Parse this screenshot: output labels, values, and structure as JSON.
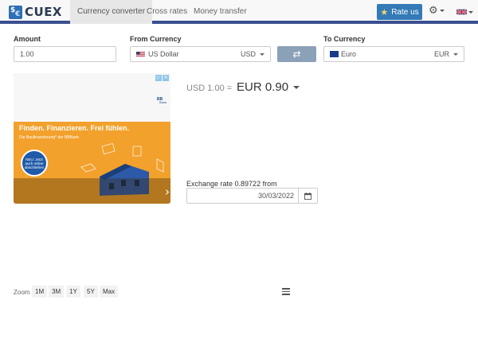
{
  "header": {
    "logo_text": "CUEX",
    "logo_mark": [
      "$",
      "€"
    ],
    "tabs": [
      {
        "label": "Currency converter",
        "active": true
      },
      {
        "label": "Cross rates",
        "active": false
      },
      {
        "label": "Money transfer",
        "active": false
      }
    ],
    "rate_button": "Rate us",
    "settings_icon": "gear-icon",
    "language_icon": "uk-flag-icon"
  },
  "form": {
    "amount_label": "Amount",
    "amount_value": "1.00",
    "from_label": "From Currency",
    "from_name": "US Dollar",
    "from_code": "USD",
    "to_label": "To Currency",
    "to_name": "Euro",
    "to_code": "EUR",
    "swap_icon": "swap-arrows-icon"
  },
  "ad": {
    "headline": "Finden. Finanzieren. Frei fühlen.",
    "subline": "Die Baufinanzierung* der BBBank",
    "badge": "NEU: Jetzt auch online abschließen",
    "brand": "BB Bank"
  },
  "result": {
    "from_text": "USD 1.00 =",
    "to_text": "EUR 0.90",
    "rate_label": "Exchange rate 0.89722 from",
    "date": "30/03/2022"
  },
  "chart_controls": {
    "zoom_label": "Zoom",
    "zoom_options": [
      "1M",
      "3M",
      "1Y",
      "5Y",
      "Max"
    ],
    "menu_icon": "hamburger-menu-icon"
  },
  "colors": {
    "brand_blue": "#337ab7",
    "nav_border": "#3a4f8f",
    "swap_button": "#8ba1b8",
    "ad_orange": "#f2a12c"
  }
}
